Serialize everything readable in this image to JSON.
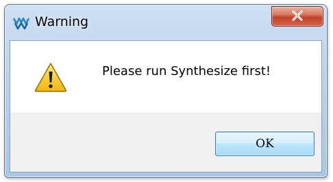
{
  "window": {
    "title": "Warning",
    "app_icon": "app-logo-icon",
    "close_icon": "close-icon"
  },
  "dialog": {
    "icon": "warning-icon",
    "message": "Please run Synthesize first!",
    "ok_label": "OK"
  },
  "colors": {
    "close_button": "#c8452d",
    "ok_button_border": "#3c7fb1",
    "titlebar": "#bcd3ec",
    "warning_yellow": "#f4c21c"
  }
}
